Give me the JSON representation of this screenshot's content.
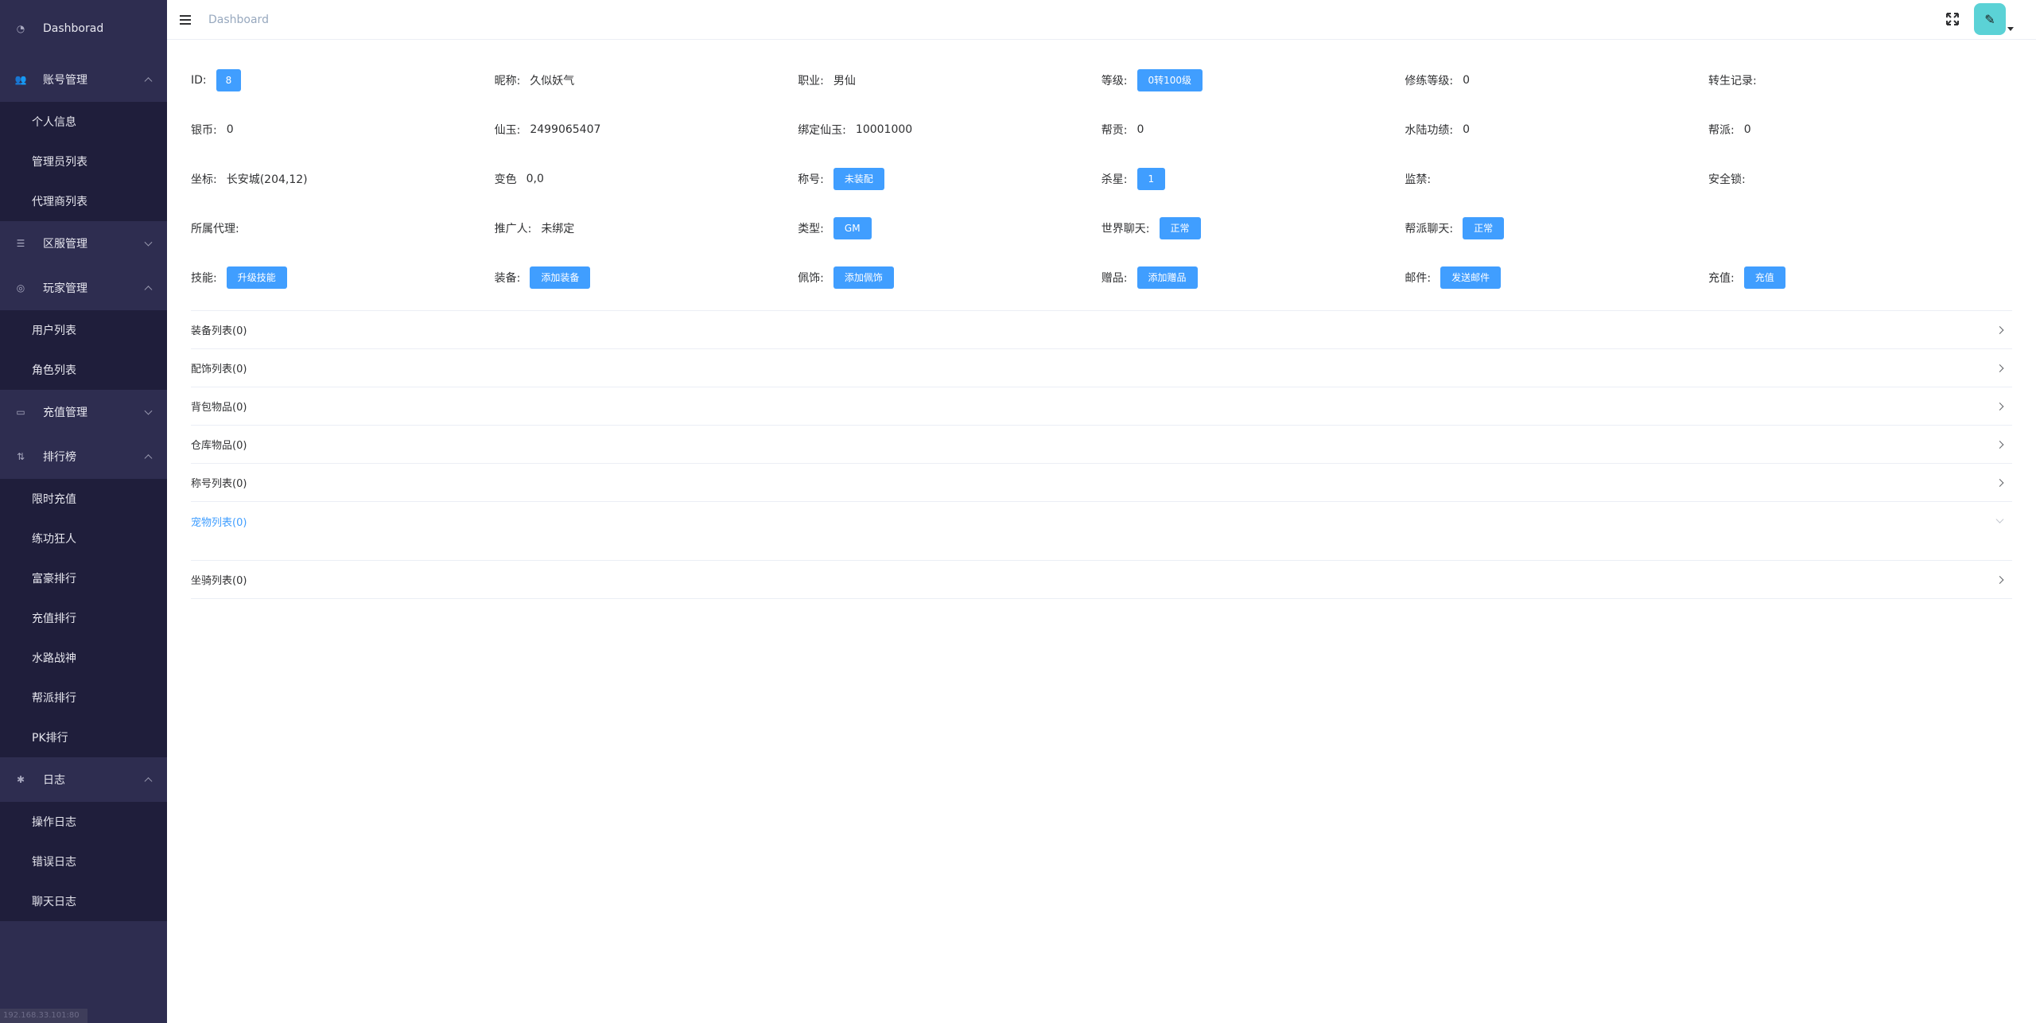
{
  "sidebar": {
    "top": {
      "label": "Dashborad",
      "icon": "dashboard-icon"
    },
    "groups": [
      {
        "label": "账号管理",
        "icon": "users-icon",
        "expanded": true,
        "children": [
          "个人信息",
          "管理员列表",
          "代理商列表"
        ]
      },
      {
        "label": "区服管理",
        "icon": "list-icon",
        "expanded": false,
        "children": []
      },
      {
        "label": "玩家管理",
        "icon": "gamepad-icon",
        "expanded": true,
        "children": [
          "用户列表",
          "角色列表"
        ]
      },
      {
        "label": "充值管理",
        "icon": "money-icon",
        "expanded": false,
        "children": []
      },
      {
        "label": "排行榜",
        "icon": "sort-icon",
        "expanded": true,
        "children": [
          "限时充值",
          "练功狂人",
          "富豪排行",
          "充值排行",
          "水路战神",
          "帮派排行",
          "PK排行"
        ]
      },
      {
        "label": "日志",
        "icon": "bug-icon",
        "expanded": true,
        "children": [
          "操作日志",
          "错误日志",
          "聊天日志"
        ]
      }
    ],
    "footer": "192.168.33.101:80"
  },
  "header": {
    "breadcrumb": "Dashboard"
  },
  "info": {
    "id_label": "ID:",
    "id_value": "8",
    "nickname_label": "昵称:",
    "nickname_value": "久似妖气",
    "job_label": "职业:",
    "job_value": "男仙",
    "level_label": "等级:",
    "level_value": "0转100级",
    "cultivation_label": "修练等级:",
    "cultivation_value": "0",
    "rebirth_label": "转生记录:",
    "rebirth_value": "",
    "silver_label": "银币:",
    "silver_value": "0",
    "jade_label": "仙玉:",
    "jade_value": "2499065407",
    "bound_jade_label": "绑定仙玉:",
    "bound_jade_value": "10001000",
    "contribution_label": "帮贡:",
    "contribution_value": "0",
    "water_label": "水陆功绩:",
    "water_value": "0",
    "guild_label": "帮派:",
    "guild_value": "0",
    "coord_label": "坐标:",
    "coord_value": "长安城(204,12)",
    "transform_label": "变色",
    "transform_value": "0,0",
    "title_label": "称号:",
    "title_value": "未装配",
    "kill_label": "杀星:",
    "kill_value": "1",
    "prison_label": "监禁:",
    "prison_value": "",
    "lock_label": "安全锁:",
    "lock_value": "",
    "agent_label": "所属代理:",
    "agent_value": "",
    "promoter_label": "推广人:",
    "promoter_value": "未绑定",
    "type_label": "类型:",
    "type_value": "GM",
    "world_chat_label": "世界聊天:",
    "world_chat_value": "正常",
    "guild_chat_label": "帮派聊天:",
    "guild_chat_value": "正常",
    "skill_label": "技能:",
    "skill_btn": "升级技能",
    "equip_label": "装备:",
    "equip_btn": "添加装备",
    "ornament_label": "佩饰:",
    "ornament_btn": "添加佩饰",
    "gift_label": "赠品:",
    "gift_btn": "添加赠品",
    "mail_label": "邮件:",
    "mail_btn": "发送邮件",
    "recharge_label": "充值:",
    "recharge_btn": "充值"
  },
  "panels": [
    {
      "label": "装备列表(0)",
      "active": false
    },
    {
      "label": "配饰列表(0)",
      "active": false
    },
    {
      "label": "背包物品(0)",
      "active": false
    },
    {
      "label": "仓库物品(0)",
      "active": false
    },
    {
      "label": "称号列表(0)",
      "active": false
    },
    {
      "label": "宠物列表(0)",
      "active": true
    },
    {
      "label": "坐骑列表(0)",
      "active": false
    }
  ],
  "colors": {
    "sidebar": "#2e2d50",
    "sidebar_sub": "#1f1e3b",
    "primary": "#409eff",
    "avatar": "#5bd2d6"
  }
}
